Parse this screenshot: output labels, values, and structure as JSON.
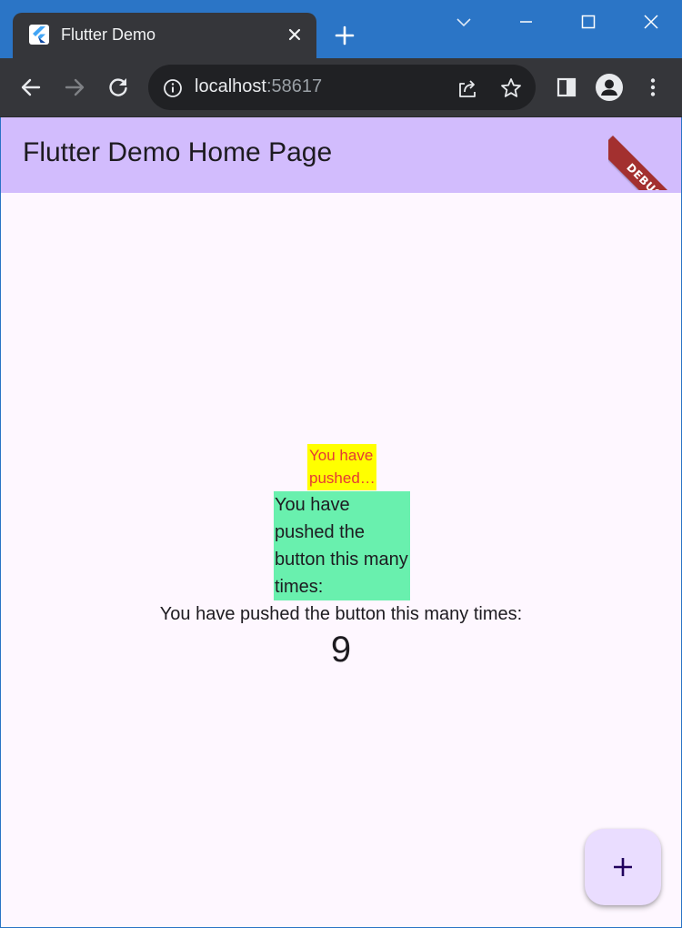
{
  "browser": {
    "tab": {
      "title": "Flutter Demo",
      "favicon": "flutter-logo-icon",
      "close_icon": "close-icon"
    },
    "new_tab_icon": "plus-icon",
    "window_controls": [
      "chevron-down-icon",
      "minimize-icon",
      "maximize-icon",
      "close-icon"
    ],
    "toolbar": {
      "back_icon": "arrow-left-icon",
      "forward_icon": "arrow-right-icon",
      "reload_icon": "reload-icon",
      "omnibox": {
        "info_icon": "info-icon",
        "url_host": "localhost",
        "url_port": ":58617",
        "share_icon": "share-icon",
        "bookmark_icon": "star-icon"
      },
      "side_panel_icon": "side-panel-icon",
      "profile_icon": "person-icon",
      "menu_icon": "kebab-menu-icon"
    },
    "colors": {
      "titlebar": "#2b75c6",
      "tab": "#35363a",
      "omnibox": "#202124"
    }
  },
  "app": {
    "app_bar_title": "Flutter Demo Home Page",
    "debug_banner": "DEBUG",
    "yellow_box_text": "You have pushed the button this many times:",
    "green_box_text": "You have pushed the button this many times:",
    "counter_label": "You have pushed the button this many times:",
    "counter_value": "9",
    "fab_icon": "plus-icon",
    "colors": {
      "background": "#fef7ff",
      "app_bar": "#d2bcfd",
      "yellow_box": "#ffff00",
      "yellow_text": "#e53935",
      "green_box": "#69f0ae",
      "fab": "#eaddff",
      "debug_banner": "#a3302f"
    }
  }
}
